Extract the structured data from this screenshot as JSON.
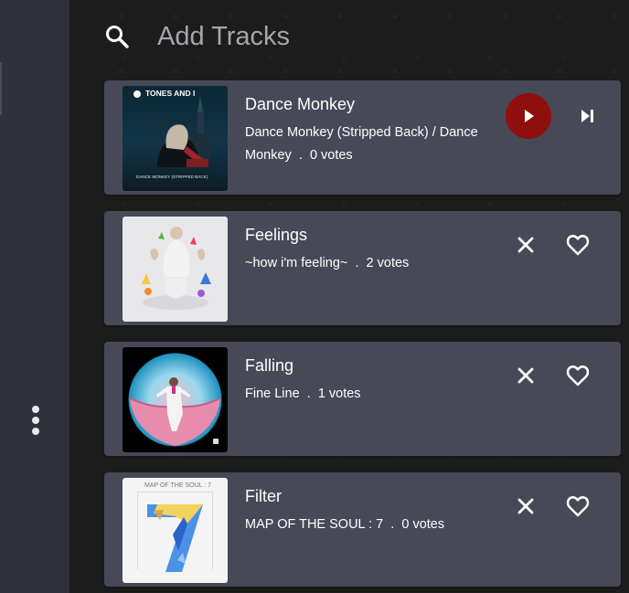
{
  "search": {
    "placeholder": "Add Tracks",
    "icon": "search-icon"
  },
  "sidebar": {
    "more_icon": "more-vertical-icon"
  },
  "tracks": [
    {
      "title": "Dance Monkey",
      "album": "Dance Monkey (Stripped Back) / Dance Monkey",
      "separator": ".",
      "votes": "0 votes",
      "cover_artist_text": "TONES AND I",
      "cover_caption_text": "DANCE MONKEY (STRIPPED BACK)",
      "now_playing": true,
      "actions": [
        "play-icon",
        "skip-next-icon"
      ]
    },
    {
      "title": "Feelings",
      "album": "~how i'm feeling~",
      "separator": ".",
      "votes": "2 votes",
      "now_playing": false,
      "actions": [
        "close-icon",
        "heart-icon"
      ]
    },
    {
      "title": "Falling",
      "album": "Fine Line",
      "separator": ".",
      "votes": "1 votes",
      "now_playing": false,
      "actions": [
        "close-icon",
        "heart-icon"
      ]
    },
    {
      "title": "Filter",
      "album": "MAP OF THE SOUL : 7",
      "separator": ".",
      "votes": "0 votes",
      "cover_text": "MAP OF THE SOUL : 7",
      "now_playing": false,
      "actions": [
        "close-icon",
        "heart-icon"
      ]
    }
  ],
  "colors": {
    "sidebar": "#2f323a",
    "card": "#474957",
    "play_button": "#8f0e0e",
    "text": "#ffffff",
    "placeholder": "#a6a6ab"
  }
}
